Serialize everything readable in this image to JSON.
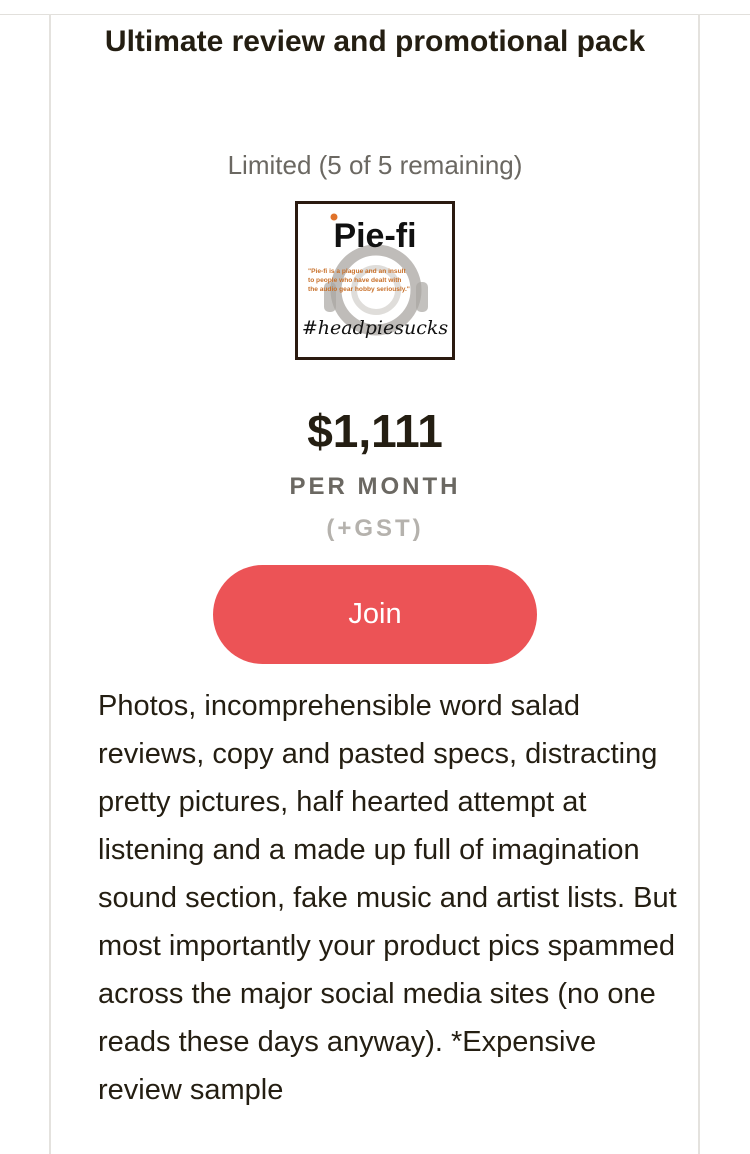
{
  "tier": {
    "title": "Ultimate review and promotional pack",
    "limit": "Limited (5 of 5 remaining)",
    "image": {
      "logo_text": "Pie-fi",
      "quote_line_1": "\"Pie-fi is a plague and an insult",
      "quote_line_2": "to people who have dealt with",
      "quote_line_3": "the audio gear hobby seriously.\"",
      "hashtag": "#headpiesucks"
    },
    "price": "$1,111",
    "period": "PER MONTH",
    "tax_note": "(+GST)",
    "join_label": "Join",
    "description": "Photos, incomprehensible word salad reviews, copy and pasted specs, distracting pretty pictures, half hearted attempt at listening and a made up full of imagination sound section, fake music and artist lists. But most importantly your product pics spammed across the major social media sites (no one reads these days anyway). *Expensive review sample"
  },
  "colors": {
    "join_button": "#ec5356",
    "heading_text": "#241e12",
    "muted_text": "#6b6862",
    "tax_text": "#b5b2ad",
    "card_border": "#e4e2de",
    "image_frame": "#2a1a10",
    "image_accent": "#c87a3a"
  }
}
